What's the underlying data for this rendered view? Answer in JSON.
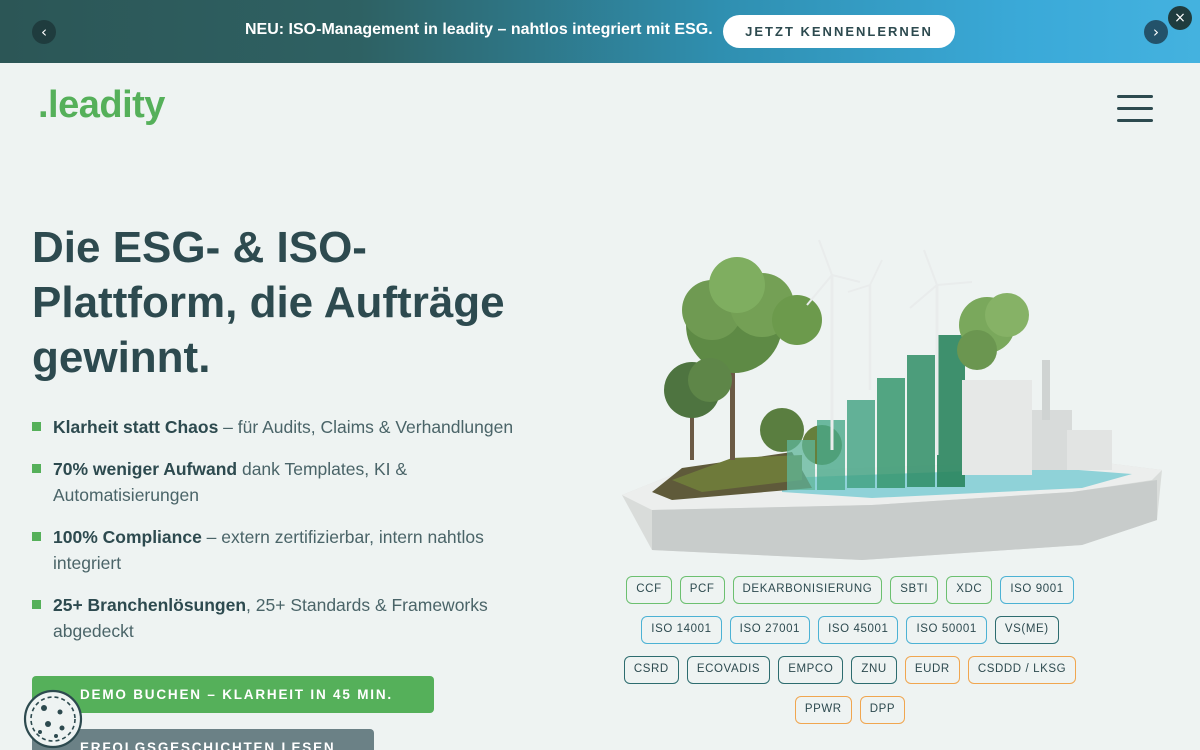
{
  "banner": {
    "message": "NEU: ISO-Management in leadity – nahtlos integriert mit ESG.",
    "cta_label": "JETZT KENNENLERNEN",
    "prev_icon": "chevron-left-icon",
    "next_icon": "chevron-right-icon",
    "close_icon": "close-icon"
  },
  "header": {
    "logo_text": ".leadity",
    "menu_icon": "hamburger-icon"
  },
  "hero": {
    "title": "Die ESG- & ISO-Plattform, die Aufträge gewinnt.",
    "bullets": [
      {
        "bold": "Klarheit statt Chaos",
        "rest": " – für Audits, Claims & Verhandlungen"
      },
      {
        "bold": "70% weniger Aufwand",
        "rest": " dank Templates, KI & Automatisierungen"
      },
      {
        "bold": "100% Compliance",
        "rest": " – extern zertifizierbar, intern nahtlos integriert"
      },
      {
        "bold": "25+ Branchenlösungen",
        "rest": ", 25+ Standards & Frameworks abgedeckt"
      }
    ],
    "primary_cta": "DEMO BUCHEN – KLARHEIT IN 45 MIN.",
    "secondary_cta": "ERFOLGSGESCHICHTEN LESEN"
  },
  "tags": {
    "row1": [
      {
        "label": "CCF",
        "color": "green"
      },
      {
        "label": "PCF",
        "color": "green"
      },
      {
        "label": "DEKARBONISIERUNG",
        "color": "green"
      },
      {
        "label": "SBTI",
        "color": "green"
      },
      {
        "label": "XDC",
        "color": "green"
      },
      {
        "label": "ISO 9001",
        "color": "blue"
      }
    ],
    "row2": [
      {
        "label": "ISO 14001",
        "color": "blue"
      },
      {
        "label": "ISO 27001",
        "color": "blue"
      },
      {
        "label": "ISO 45001",
        "color": "blue"
      },
      {
        "label": "ISO 50001",
        "color": "blue"
      },
      {
        "label": "VS(ME)",
        "color": "teal"
      }
    ],
    "row3": [
      {
        "label": "CSRD",
        "color": "teal"
      },
      {
        "label": "ECOVADIS",
        "color": "teal"
      },
      {
        "label": "EMPCO",
        "color": "teal"
      },
      {
        "label": "ZNU",
        "color": "teal"
      },
      {
        "label": "EUDR",
        "color": "orange"
      },
      {
        "label": "CSDDD / LKSG",
        "color": "orange"
      }
    ],
    "row4": [
      {
        "label": "PPWR",
        "color": "orange"
      },
      {
        "label": "DPP",
        "color": "orange"
      }
    ]
  },
  "colors": {
    "brand_green": "#55b05a",
    "dark_teal": "#2d4a4f",
    "accent_blue": "#4cb2d4",
    "accent_orange": "#f0a650"
  },
  "cookie_icon": "cookie-icon"
}
